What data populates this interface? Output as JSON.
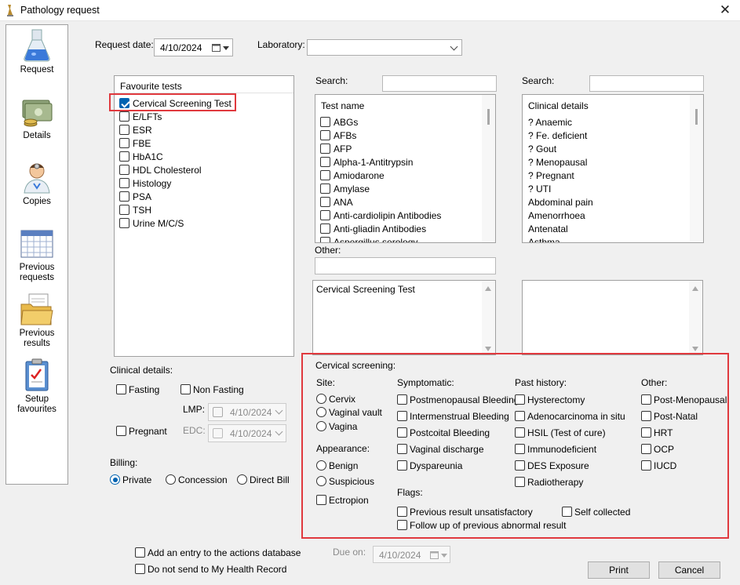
{
  "window": {
    "title": "Pathology request",
    "close_glyph": "✕"
  },
  "nav": {
    "request": "Request",
    "details": "Details",
    "copies": "Copies",
    "prev_requests_1": "Previous",
    "prev_requests_2": "requests",
    "prev_results_1": "Previous",
    "prev_results_2": "results",
    "setup_fav_1": "Setup",
    "setup_fav_2": "favourites"
  },
  "request_date": {
    "label": "Request date:",
    "value": "4/10/2024"
  },
  "laboratory": {
    "label": "Laboratory:",
    "value": ""
  },
  "favourites": {
    "header": "Favourite tests",
    "items": [
      {
        "label": "Cervical Screening Test",
        "checked": true
      },
      {
        "label": "E/LFTs",
        "checked": false
      },
      {
        "label": "ESR",
        "checked": false
      },
      {
        "label": "FBE",
        "checked": false
      },
      {
        "label": "HbA1C",
        "checked": false
      },
      {
        "label": "HDL Cholesterol",
        "checked": false
      },
      {
        "label": "Histology",
        "checked": false
      },
      {
        "label": "PSA",
        "checked": false
      },
      {
        "label": "TSH",
        "checked": false
      },
      {
        "label": "Urine M/C/S",
        "checked": false
      }
    ]
  },
  "tests": {
    "search_label": "Search:",
    "search_value": "",
    "header": "Test name",
    "items": [
      "ABGs",
      "AFBs",
      "AFP",
      "Alpha-1-Antitrypsin",
      "Amiodarone",
      "Amylase",
      "ANA",
      "Anti-cardiolipin Antibodies",
      "Anti-gliadin Antibodies",
      "Aspergillus serology"
    ]
  },
  "clinical_list": {
    "search_label": "Search:",
    "search_value": "",
    "header": "Clinical details",
    "items": [
      "? Anaemic",
      "? Fe. deficient",
      "? Gout",
      "? Menopausal",
      "? Pregnant",
      "? UTI",
      "Abdominal pain",
      "Amenorrhoea",
      "Antenatal",
      "Asthma"
    ]
  },
  "other": {
    "label": "Other:",
    "value": ""
  },
  "selected_tests_text": "Cervical Screening Test",
  "clinical_details": {
    "label": "Clinical details:",
    "fasting": "Fasting",
    "non_fasting": "Non Fasting",
    "lmp_label": "LMP:",
    "lmp_value": "4/10/2024",
    "pregnant": "Pregnant",
    "edc_label": "EDC:",
    "edc_value": "4/10/2024"
  },
  "billing": {
    "label": "Billing:",
    "options": [
      "Private",
      "Concession",
      "Direct Bill"
    ],
    "selected": "Private"
  },
  "cervical": {
    "title": "Cervical screening:",
    "site_label": "Site:",
    "site": [
      "Cervix",
      "Vaginal vault",
      "Vagina"
    ],
    "appearance_label": "Appearance:",
    "appearance": [
      "Benign",
      "Suspicious"
    ],
    "ectropion": "Ectropion",
    "symptomatic_label": "Symptomatic:",
    "symptomatic": [
      "Postmenopausal Bleeding",
      "Intermenstrual Bleeding",
      "Postcoital Bleeding",
      "Vaginal discharge",
      "Dyspareunia"
    ],
    "past_label": "Past history:",
    "past": [
      "Hysterectomy",
      "Adenocarcinoma in situ",
      "HSIL (Test of cure)",
      "Immunodeficient",
      "DES Exposure",
      "Radiotherapy"
    ],
    "other_label": "Other:",
    "other": [
      "Post-Menopausal",
      "Post-Natal",
      "HRT",
      "OCP",
      "IUCD"
    ],
    "flags_label": "Flags:",
    "flags": [
      "Previous result unsatisfactory",
      "Self collected",
      "Follow up of previous abnormal result"
    ]
  },
  "footer": {
    "add_entry": "Add an entry to the actions database",
    "no_mhr": "Do not send to My Health Record",
    "due_label": "Due on:",
    "due_value": "4/10/2024",
    "print": "Print",
    "cancel": "Cancel"
  },
  "colors": {
    "accent": "#0063b1",
    "highlight": "#e0393e",
    "window_bg": "#f0f0f0"
  }
}
